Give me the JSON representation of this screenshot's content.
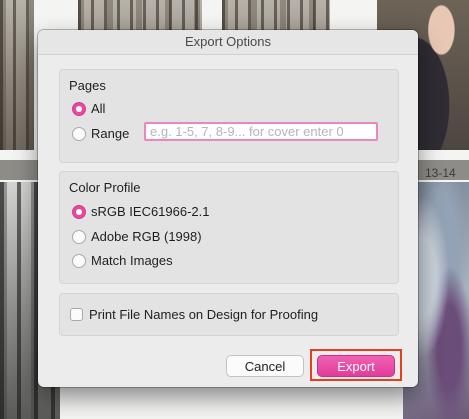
{
  "background": {
    "page_label": "13-14"
  },
  "dialog": {
    "title": "Export Options",
    "pages": {
      "title": "Pages",
      "options": [
        {
          "label": "All",
          "selected": true
        },
        {
          "label": "Range",
          "selected": false
        }
      ],
      "range_placeholder": "e.g. 1-5, 7, 8-9... for cover enter 0",
      "range_value": ""
    },
    "color_profile": {
      "title": "Color Profile",
      "options": [
        {
          "label": "sRGB IEC61966-2.1",
          "selected": true
        },
        {
          "label": "Adobe RGB (1998)",
          "selected": false
        },
        {
          "label": "Match Images",
          "selected": false
        }
      ]
    },
    "print_file_names": {
      "label": "Print File Names on Design for Proofing",
      "checked": false
    },
    "buttons": {
      "cancel": "Cancel",
      "export": "Export"
    }
  },
  "colors": {
    "accent": "#e8489f",
    "highlight": "#e23f1c"
  },
  "icons": {
    "radio_selected": "radio-on-icon",
    "radio_unselected": "radio-off-icon",
    "checkbox": "checkbox-icon"
  }
}
